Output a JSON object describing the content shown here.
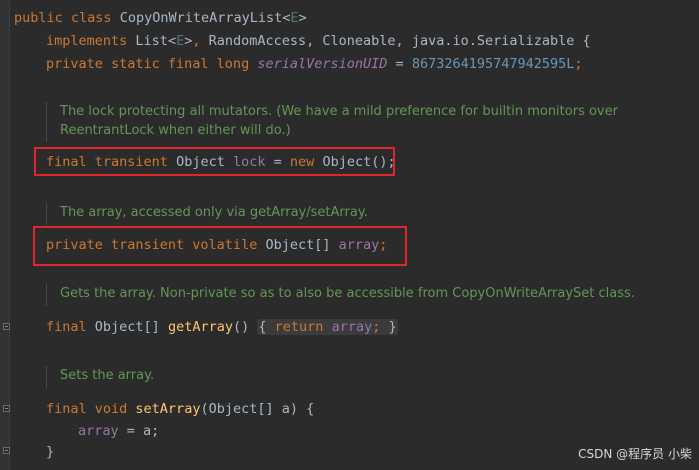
{
  "code": {
    "line1": {
      "kw1": "public",
      "kw2": "class",
      "name": "CopyOnWriteArrayList",
      "tparam": "E"
    },
    "line2": {
      "kw": "implements",
      "list": "List",
      "tparam": "E",
      "rest": "RandomAccess, Cloneable, java.io.Serializable {"
    },
    "line3": {
      "kw": "private static final long",
      "field": "serialVersionUID",
      "eq": "=",
      "num": "8673264195747942595L",
      "semi": ";"
    },
    "doc1": "The lock protecting all mutators. (We have a mild preference for builtin monitors over ReentrantLock when either will do.)",
    "line4": {
      "kw": "final transient",
      "type": "Object",
      "field": "lock",
      "eq": "=",
      "kw2": "new",
      "ctor": "Object();"
    },
    "doc2": "The array, accessed only via getArray/setArray.",
    "line5": {
      "kw": "private transient volatile",
      "type": "Object[]",
      "field": "array",
      "semi": ";"
    },
    "doc3": "Gets the array. Non-private so as to also be accessible from CopyOnWriteArraySet class.",
    "line6": {
      "kw": "final",
      "type": "Object[]",
      "fn": "getArray",
      "paren": "()",
      "lbrace": "{",
      "kw2": "return",
      "field": "array",
      "semi": ";",
      "rbrace": "}"
    },
    "doc4": "Sets the array.",
    "line7": {
      "kw": "final void",
      "fn": "setArray",
      "params": "(Object[] a) {"
    },
    "line8": {
      "field": "array",
      "rest": "= a;"
    },
    "line9": {
      "brace": "}"
    }
  },
  "watermark": "CSDN @程序员 小柴"
}
